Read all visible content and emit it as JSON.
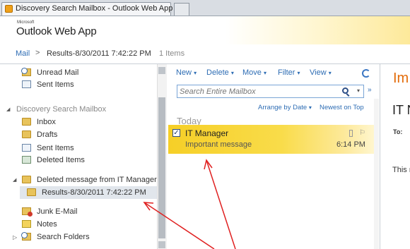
{
  "browser": {
    "tab_title": "Discovery Search Mailbox - Outlook Web App",
    "tab_icon": "owa-icon"
  },
  "header": {
    "brand_small": "Microsoft",
    "brand": "Outlook Web App"
  },
  "breadcrumb": {
    "root": "Mail",
    "separator": ">",
    "location": "Results-8/30/2011 7:42:22 PM",
    "count": "1 Items"
  },
  "folders": {
    "items": [
      {
        "label": "Unread Mail",
        "icon": "unread-mail-icon"
      },
      {
        "label": "Sent Items",
        "icon": "sent-items-icon"
      },
      {
        "label": "Discovery Search Mailbox",
        "icon": ""
      },
      {
        "label": "Inbox",
        "icon": "inbox-icon"
      },
      {
        "label": "Drafts",
        "icon": "drafts-icon"
      },
      {
        "label": "Sent Items",
        "icon": "sent-items-icon"
      },
      {
        "label": "Deleted Items",
        "icon": "deleted-items-icon"
      },
      {
        "label": "Deleted message from IT Manager",
        "icon": "folder-icon"
      },
      {
        "label": "Results-8/30/2011 7:42:22 PM",
        "icon": "folder-icon"
      },
      {
        "label": "Junk E-Mail",
        "icon": "junk-email-icon"
      },
      {
        "label": "Notes",
        "icon": "notes-icon"
      },
      {
        "label": "Search Folders",
        "icon": "search-folders-icon"
      }
    ]
  },
  "toolbar": {
    "new": "New",
    "delete": "Delete",
    "move": "Move",
    "filter": "Filter",
    "view": "View",
    "caret": "▾"
  },
  "search": {
    "placeholder": "Search Entire Mailbox"
  },
  "list": {
    "arrange": "Arrange by Date",
    "arrange_caret": "▾",
    "order": "Newest on Top",
    "group": "Today",
    "messages": [
      {
        "from": "IT Manager",
        "subject": "Important message",
        "time": "6:14 PM",
        "checked": true
      }
    ]
  },
  "reading": {
    "title": "Im",
    "from": "IT N",
    "to_label": "To:",
    "body": "This m"
  },
  "colors": {
    "accent": "#2e6db4",
    "selected_message": "#f6cf27",
    "reading_title": "#e36c0a",
    "annotation": "#e02020"
  }
}
